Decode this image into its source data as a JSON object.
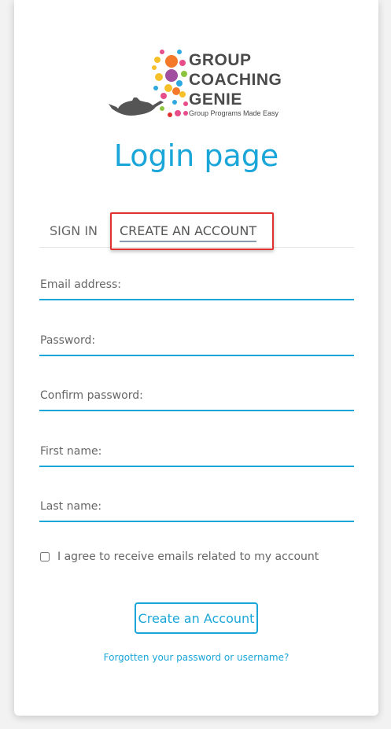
{
  "logo": {
    "line1": "GROUP",
    "line2": "COACHING",
    "line3": "GENIE",
    "tagline": "Group Programs Made Easy"
  },
  "page_title": "Login page",
  "tabs": [
    {
      "label": "SIGN IN"
    },
    {
      "label": "CREATE AN ACCOUNT"
    }
  ],
  "form": {
    "email_placeholder": "Email address:",
    "password_placeholder": "Password:",
    "confirm_password_placeholder": "Confirm password:",
    "first_name_placeholder": "First name:",
    "last_name_placeholder": "Last name:",
    "agree_label": "I agree to receive emails related to my account",
    "submit_label": "Create an Account"
  },
  "forgot_link": "Forgotten your password or username?",
  "colors": {
    "accent": "#1aa6d8",
    "highlight": "#e03030",
    "text": "#666666"
  }
}
